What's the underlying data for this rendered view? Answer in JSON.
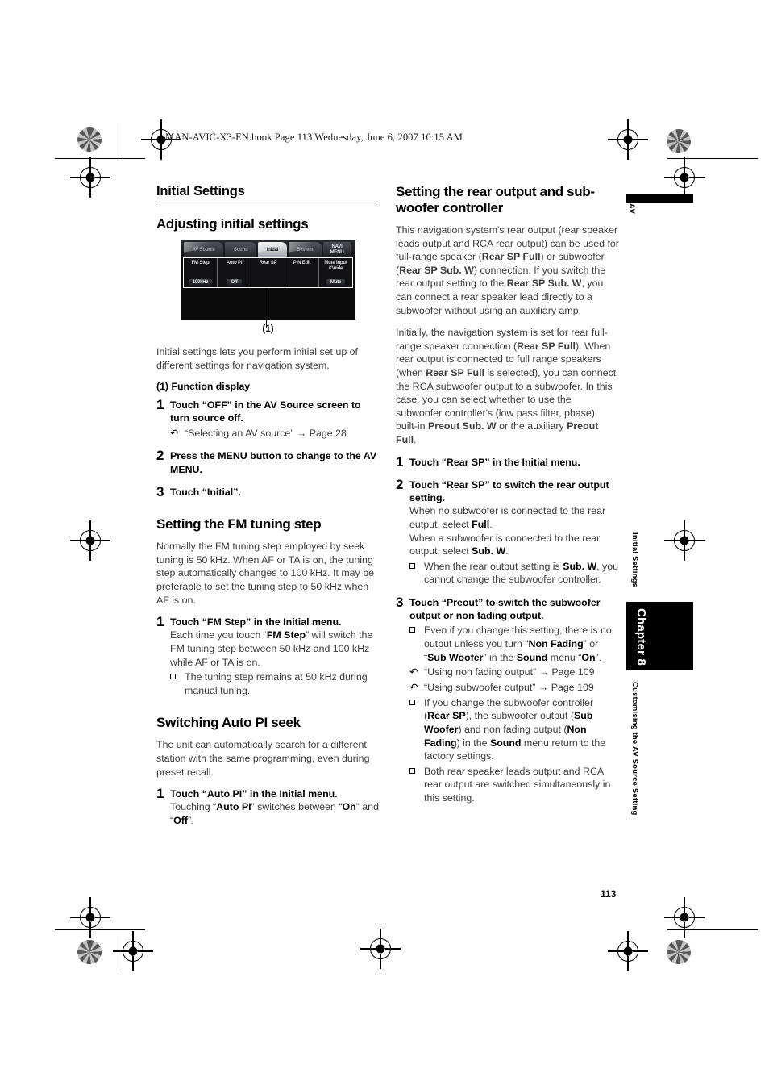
{
  "page": {
    "book_line": "MAN-AVIC-X3-EN.book  Page 113  Wednesday, June 6, 2007  10:15 AM",
    "folio": "113"
  },
  "edge": {
    "av": "AV",
    "running_head": "Initial Settings",
    "chapter": "Chapter 8",
    "chapter_subtitle": "Customising the AV Source Setting"
  },
  "left": {
    "section_title": "Initial Settings",
    "heading_adjust": "Adjusting initial settings",
    "figure": {
      "caption": "(1)",
      "tabs": [
        {
          "label": "AV Source",
          "active": false
        },
        {
          "label": "Sound",
          "active": false
        },
        {
          "label": "Initial",
          "active": true
        },
        {
          "label": "System",
          "active": false
        }
      ],
      "navi_line1": "NAVI",
      "navi_line2": "MENU",
      "functions": [
        {
          "label": "FM Step",
          "value": "100kHz"
        },
        {
          "label": "Auto PI",
          "value": "Off"
        },
        {
          "label": "Rear SP",
          "value": ""
        },
        {
          "label": "PIN Edit",
          "value": ""
        },
        {
          "label": "Mute Input\n/Guide",
          "value": "Mute"
        }
      ]
    },
    "intro": "Initial settings lets you perform initial set up of different settings for navigation system.",
    "callout": "(1) Function display",
    "step1_num": "1",
    "step1_title": "Touch “OFF” in the AV Source screen to turn source off.",
    "step1_xref_glyph": "↶",
    "step1_xref": "“Selecting an AV source” → Page 28",
    "step2_num": "2",
    "step2_title": "Press the MENU button to change to the AV MENU.",
    "step3_num": "3",
    "step3_title": "Touch “Initial”.",
    "heading_fm": "Setting the FM tuning step",
    "fm_intro": "Normally the FM tuning step employed by seek tuning is 50 kHz. When AF or TA is on, the tuning step automatically changes to 100 kHz. It may be preferable to set the tuning step to 50 kHz when AF is on.",
    "fm_step_num": "1",
    "fm_step_title": "Touch “FM Step” in the Initial menu.",
    "fm_step_desc_a": "Each time you touch “",
    "fm_step_desc_bold": "FM Step",
    "fm_step_desc_b": "” will switch the FM tuning step between 50 kHz and 100 kHz while AF or TA is on.",
    "fm_note": "The tuning step remains at 50 kHz during manual tuning.",
    "heading_autopi": "Switching Auto PI seek",
    "autopi_intro": "The unit can automatically search for a different station with the same programming, even during preset recall.",
    "autopi_step_num": "1",
    "autopi_step_title": "Touch “Auto PI” in the Initial menu.",
    "autopi_desc_a": "Touching “",
    "autopi_desc_b1": "Auto PI",
    "autopi_desc_c": "” switches between “",
    "autopi_desc_b2": "On",
    "autopi_desc_d": "” and “",
    "autopi_desc_b3": "Off",
    "autopi_desc_e": "”."
  },
  "right": {
    "heading_rear": "Setting the rear output and sub-woofer controller",
    "para1_a": "This navigation system's rear output (rear speaker leads output and RCA rear output) can be used for full-range speaker (",
    "para1_b1": "Rear SP Full",
    "para1_c": ") or subwoofer (",
    "para1_b2": "Rear SP Sub. W",
    "para1_d": ") connection. If you switch the rear output setting to the ",
    "para1_b3": "Rear SP Sub. W",
    "para1_e": ", you can connect a rear speaker lead directly to a subwoofer without using an auxiliary amp.",
    "para2_a": "Initially, the navigation system is set for rear full-range speaker connection (",
    "para2_b1": "Rear SP Full",
    "para2_c": "). When rear output is connected to full range speakers (when ",
    "para2_b2": "Rear SP Full",
    "para2_d": " is selected), you can connect the RCA subwoofer output to a subwoofer. In this case, you can select whether to use the subwoofer controller's (low pass filter, phase) built-in ",
    "para2_b3": "Preout Sub. W",
    "para2_e": " or the auxiliary ",
    "para2_b4": "Preout Full",
    "para2_f": ".",
    "step1_num": "1",
    "step1_title": "Touch “Rear SP” in the Initial menu.",
    "step2_num": "2",
    "step2_title": "Touch “Rear SP” to switch the rear output setting.",
    "step2_desc_a": "When no subwoofer is connected to the rear output, select ",
    "step2_desc_b1": "Full",
    "step2_desc_c": ".",
    "step2_desc_d": "When a subwoofer is connected to the rear output, select ",
    "step2_desc_b2": "Sub. W",
    "step2_desc_e": ".",
    "step2_note_a": "When the rear output setting is ",
    "step2_note_b": "Sub. W",
    "step2_note_c": ", you cannot change the subwoofer controller.",
    "step3_num": "3",
    "step3_title": "Touch “Preout” to switch the subwoofer output or non fading output.",
    "step3_note1_a": "Even if you change this setting, there is no output unless you turn “",
    "step3_note1_b1": "Non Fading",
    "step3_note1_c": "” or “",
    "step3_note1_b2": "Sub Woofer",
    "step3_note1_d": "” in the ",
    "step3_note1_b3": "Sound",
    "step3_note1_e": " menu “",
    "step3_note1_b4": "On",
    "step3_note1_f": "”.",
    "xref_glyph": "↶",
    "xref1": "“Using non fading output” → Page 109",
    "xref2": "“Using subwoofer output” → Page 109",
    "step3_note2_a": "If you change the subwoofer controller (",
    "step3_note2_b1": "Rear SP",
    "step3_note2_c": "), the subwoofer output (",
    "step3_note2_b2": "Sub Woofer",
    "step3_note2_d": ") and non fading output (",
    "step3_note2_b3": "Non Fading",
    "step3_note2_e": ") in the ",
    "step3_note2_b4": "Sound",
    "step3_note2_f": " menu return to the factory settings.",
    "step3_note3": "Both rear speaker leads output and RCA rear output are switched simultaneously in this setting."
  }
}
